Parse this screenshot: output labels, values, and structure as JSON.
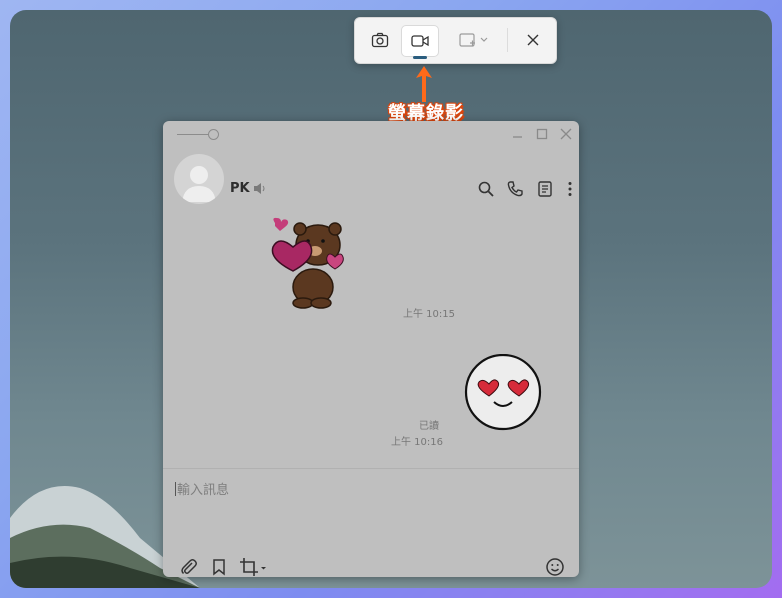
{
  "snipping_toolbar": {
    "buttons": [
      {
        "name": "camera-icon",
        "tooltip": ""
      },
      {
        "name": "video-icon"
      },
      {
        "name": "rectangle-mode-icon"
      },
      {
        "name": "close-icon"
      }
    ]
  },
  "annotation": {
    "text": "螢幕錄影",
    "color": "#ff6a1a"
  },
  "chat": {
    "contact_name": "PK",
    "messages": [
      {
        "type": "sticker",
        "sticker": "brown-bear-heart",
        "time": "上午 10:15"
      },
      {
        "type": "sticker",
        "sticker": "heart-eyes-face",
        "read_status": "已讀",
        "time": "上午 10:16"
      }
    ],
    "input_placeholder": "輸入訊息"
  },
  "colors": {
    "accent": "#2a5d7f",
    "chat_bg": "#bfbfbf"
  }
}
